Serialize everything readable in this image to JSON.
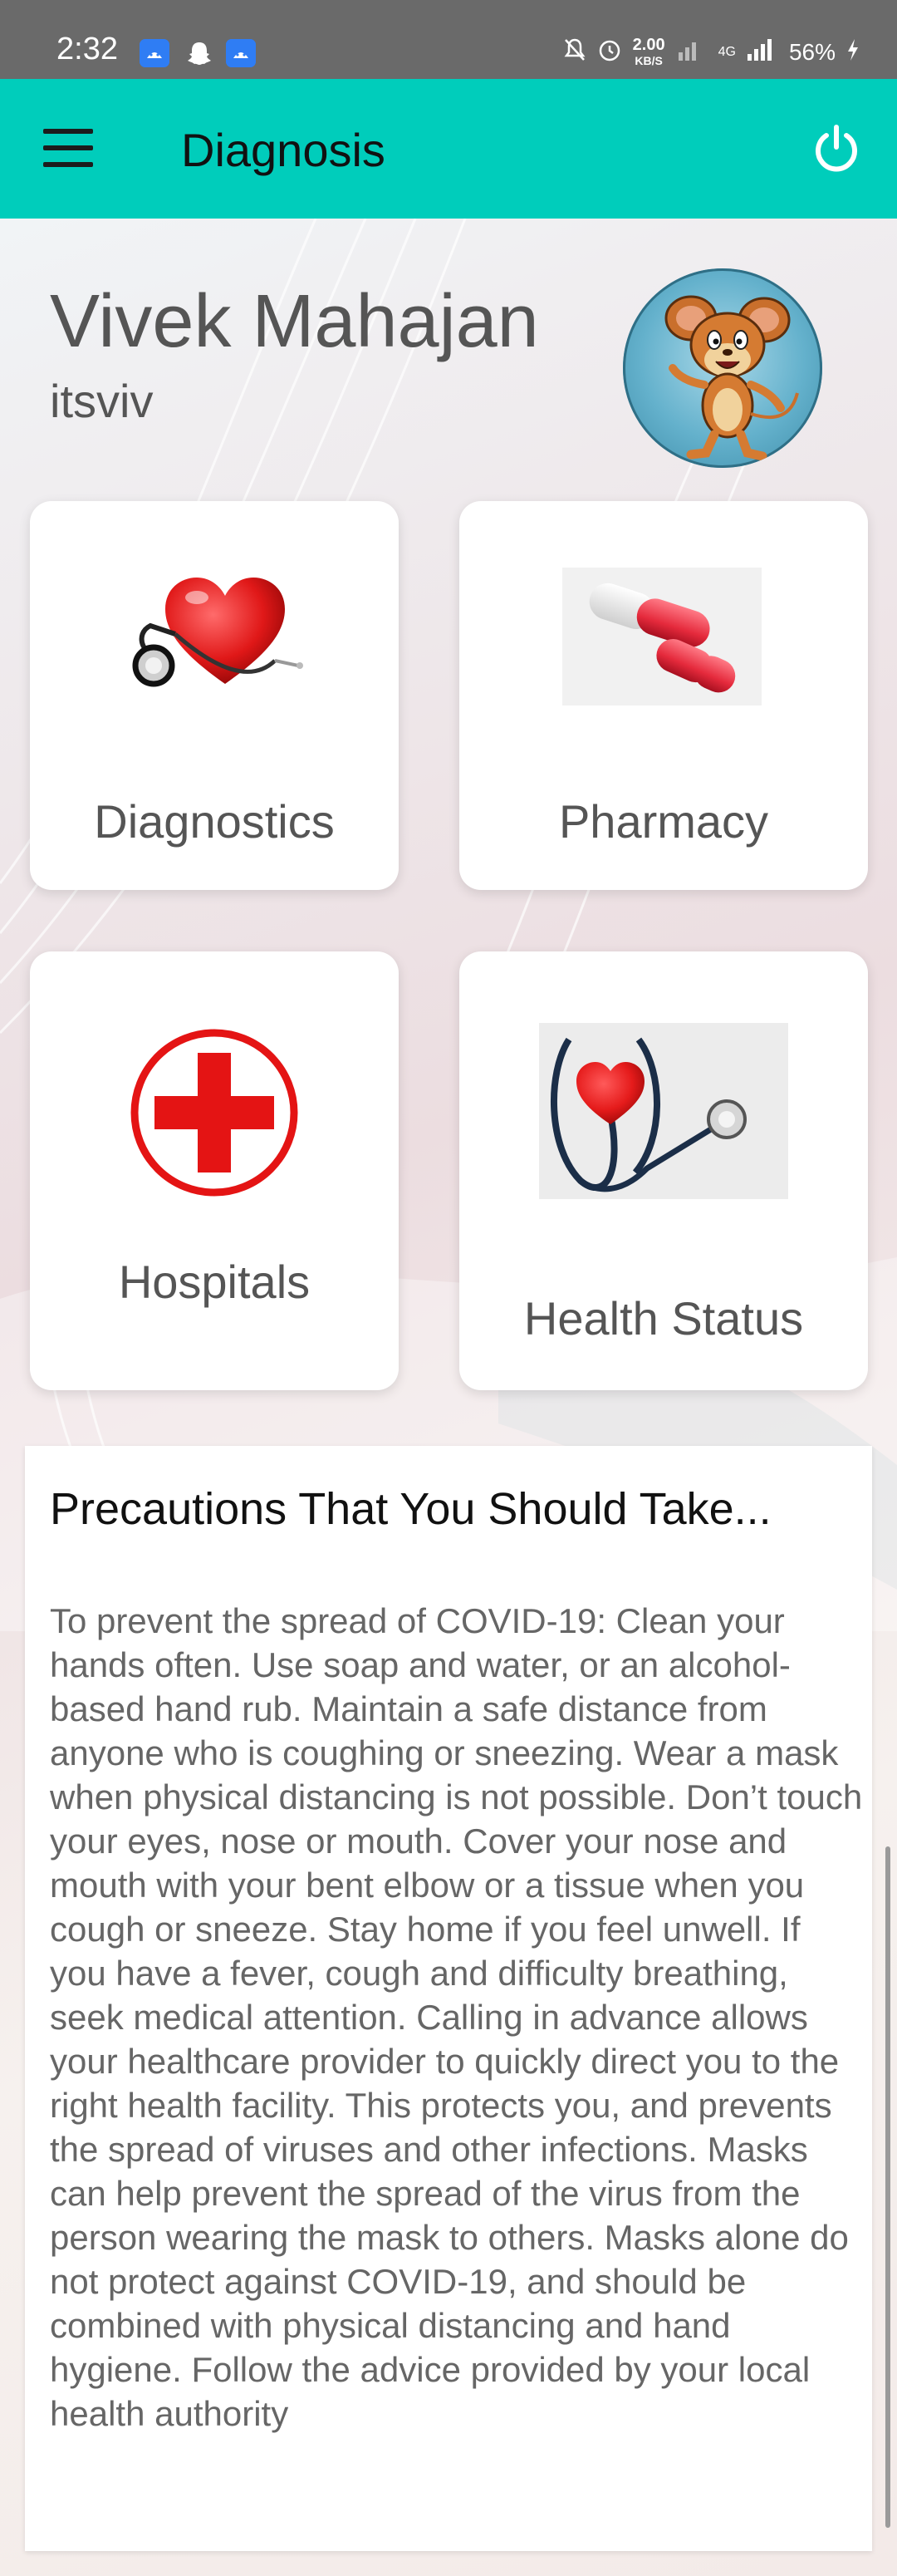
{
  "status_bar": {
    "time": "2:32",
    "network_speed": "2.00",
    "network_speed_unit": "KB/S",
    "network_type": "4G",
    "battery": "56%",
    "icons": [
      "android-notification-icon",
      "snapchat-icon",
      "android-notification-icon",
      "mute-icon",
      "alarm-icon",
      "signal-icon",
      "battery-charging-icon"
    ]
  },
  "app_bar": {
    "title": "Diagnosis",
    "background_color": "#00cdbb",
    "menu_icon": "hamburger-menu-icon",
    "power_icon": "power-icon"
  },
  "profile": {
    "name": "Vivek Mahajan",
    "username": "itsviv"
  },
  "cards": [
    {
      "label": "Diagnostics",
      "icon": "heart-stethoscope-icon"
    },
    {
      "label": "Pharmacy",
      "icon": "pill-capsules-icon"
    },
    {
      "label": "Hospitals",
      "icon": "red-cross-icon"
    },
    {
      "label": "Health Status",
      "icon": "heart-stethoscope-photo-icon"
    }
  ],
  "precautions": {
    "title": "Precautions That You Should Take...",
    "body": "To prevent the spread of COVID-19: Clean your hands often. Use soap and water, or an alcohol-based hand rub. Maintain a safe distance from anyone who is coughing or sneezing. Wear a mask when physical distancing is not possible. Don’t touch your eyes, nose or mouth. Cover your nose and mouth with your bent elbow or a tissue when you cough or sneeze. Stay home if you feel unwell. If you have a fever, cough and difficulty breathing, seek medical attention. Calling in advance allows your healthcare provider to quickly direct you to the right health facility. This protects you, and prevents the spread of viruses and other infections.  Masks can help prevent the spread of the virus from the person wearing the mask to others. Masks alone do not protect against COVID-19, and should be combined with physical distancing and hand hygiene. Follow the advice provided by your local health authority"
  }
}
